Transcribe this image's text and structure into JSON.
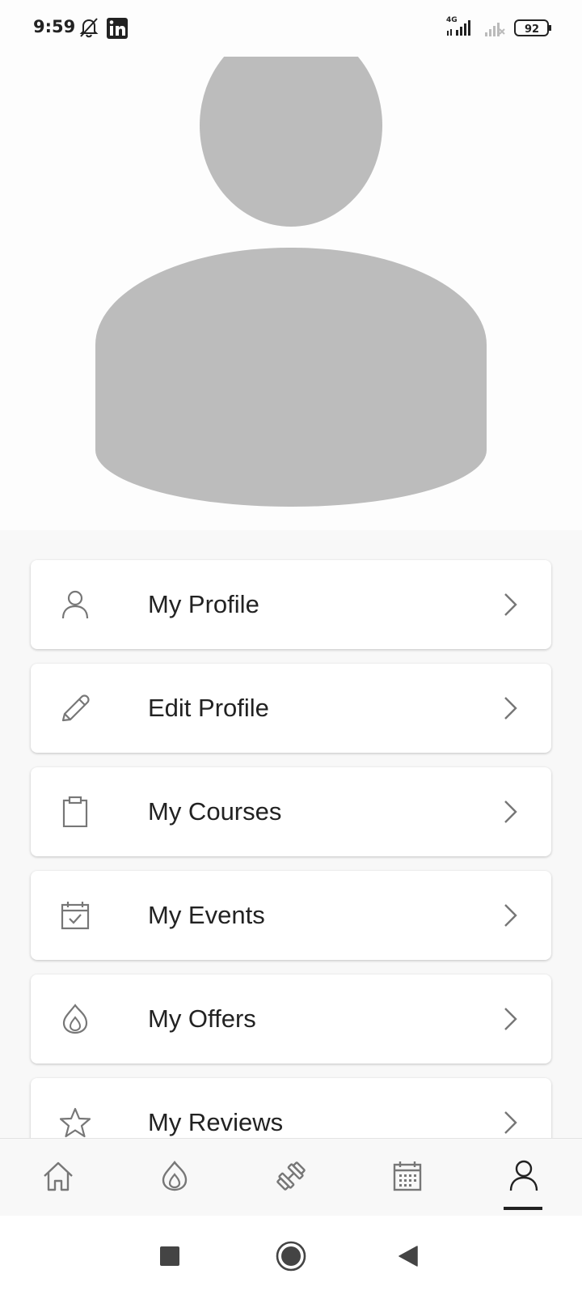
{
  "status_bar": {
    "time": "9:59",
    "network": "4G",
    "battery": "92",
    "icons": [
      "bell-off-icon",
      "linkedin-icon",
      "signal-icon",
      "signal-no-sim-icon",
      "battery-icon"
    ]
  },
  "profile": {
    "avatar": "default-person-avatar"
  },
  "menu": {
    "items": [
      {
        "label": "My Profile",
        "icon": "person-icon"
      },
      {
        "label": "Edit Profile",
        "icon": "pencil-icon"
      },
      {
        "label": "My Courses",
        "icon": "clipboard-icon"
      },
      {
        "label": "My Events",
        "icon": "calendar-check-icon"
      },
      {
        "label": "My Offers",
        "icon": "flame-icon"
      },
      {
        "label": "My Reviews",
        "icon": "star-icon"
      }
    ]
  },
  "bottom_nav": {
    "items": [
      "home-icon",
      "flame-icon",
      "dumbbell-icon",
      "calendar-icon",
      "person-icon"
    ],
    "active": "person-icon"
  },
  "system_nav": {
    "items": [
      "recents-square-icon",
      "home-circle-icon",
      "back-triangle-icon"
    ]
  },
  "colors": {
    "background": "#f8f8f8",
    "card": "#ffffff",
    "avatar": "#bcbcbc",
    "icon": "#777777",
    "text": "#222222"
  }
}
